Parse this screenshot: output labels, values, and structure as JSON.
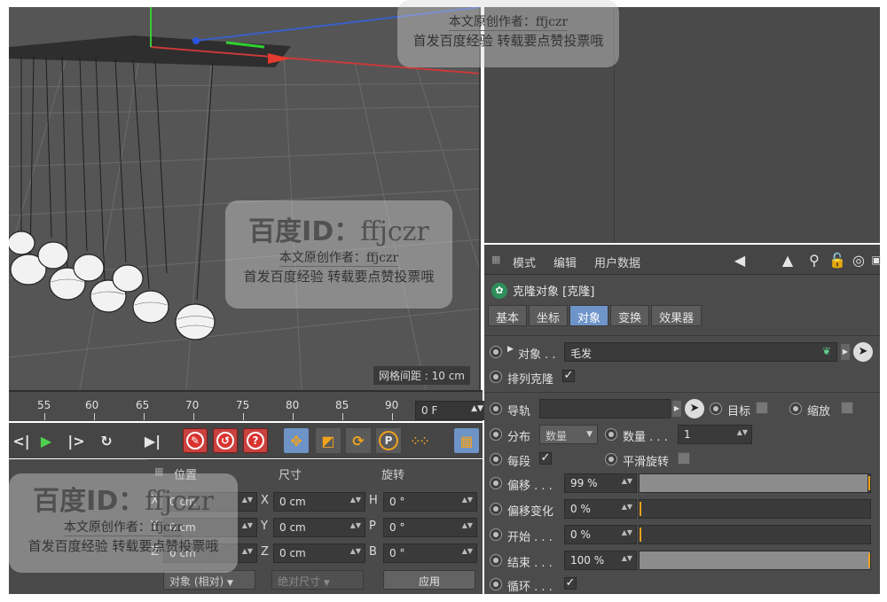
{
  "viewport": {
    "grid_label": "网格间距 : 10 cm"
  },
  "timeline": {
    "ticks": [
      "55",
      "60",
      "65",
      "70",
      "75",
      "80",
      "85",
      "90"
    ],
    "frame": "0 F"
  },
  "coords": {
    "headers": {
      "position": "位置",
      "size": "尺寸",
      "rotation": "旋转"
    },
    "axes_pos": [
      "X",
      "Y",
      "Z"
    ],
    "axes_rot": [
      "H",
      "P",
      "B"
    ],
    "position": [
      "0 cm",
      "0 cm",
      "0 cm"
    ],
    "size": [
      "0 cm",
      "0 cm",
      "0 cm"
    ],
    "rotation": [
      "0 °",
      "0 °",
      "0 °"
    ],
    "mode": "对象 (相对)",
    "size_mode": "绝对尺寸",
    "apply": "应用"
  },
  "attr": {
    "menu": {
      "mode": "模式",
      "edit": "编辑",
      "userdata": "用户数据"
    },
    "title": "克隆对象 [克隆]",
    "tabs": [
      "基本",
      "坐标",
      "对象",
      "变换",
      "效果器"
    ],
    "active_tab": "对象",
    "object_label": "对象 . .",
    "object_value": "毛发",
    "arrange_label": "排列克隆",
    "rail_label": "导轨",
    "target_label": "目标",
    "scale_label": "缩放",
    "dist_label": "分布",
    "dist_value": "数量",
    "count_label": "数量 . . .",
    "count_value": "1",
    "each_label": "每段",
    "smooth_label": "平滑旋转",
    "offset_label": "偏移 . . .",
    "offset_value": "99 %",
    "offset_var_label": "偏移变化",
    "offset_var_value": "0 %",
    "start_label": "开始 . . .",
    "start_value": "0 %",
    "end_label": "结束 . . .",
    "end_value": "100 %",
    "loop_label": "循环 . . .",
    "progress": {
      "offset": 0.99,
      "offset_var": 0.0,
      "start": 0.0,
      "end": 1.0
    }
  },
  "watermark": {
    "big": "百度ID：",
    "id": "ffjczr",
    "line2": "本文原创作者：ffjczr",
    "line3": "首发百度经验 转载要点赞投票哦"
  }
}
